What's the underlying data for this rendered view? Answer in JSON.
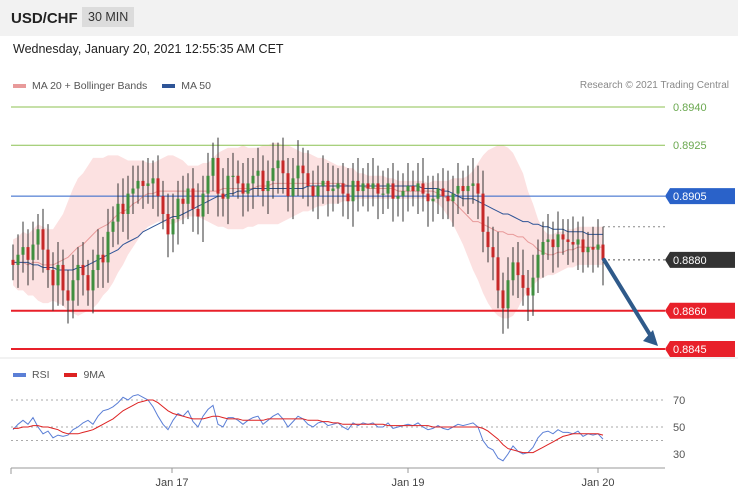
{
  "header": {
    "pair": "USD/CHF",
    "timeframe": "30 MIN"
  },
  "timestamp": "Wednesday, January 20, 2021 12:55:35 AM CET",
  "legend_main": [
    {
      "label": "MA 20 + Bollinger Bands",
      "color": "#e89a9a"
    },
    {
      "label": "MA 50",
      "color": "#2f5597"
    }
  ],
  "legend_rsi": [
    {
      "label": "RSI",
      "color": "#5b7fd6"
    },
    {
      "label": "9MA",
      "color": "#dd2222"
    }
  ],
  "credit": "Research © 2021 Trading Central",
  "colors": {
    "resistance": "#8cc152",
    "pivot": "#2a62c9",
    "support": "#e8202a",
    "last": "#333333",
    "arrow": "#2f5a8a"
  },
  "chart_data": [
    {
      "type": "candlestick",
      "pair": "USD/CHF",
      "ylim": [
        0.884,
        0.895
      ],
      "levels": [
        {
          "value": 0.894,
          "label": "0.8940",
          "kind": "resistance"
        },
        {
          "value": 0.8925,
          "label": "0.8925",
          "kind": "resistance"
        },
        {
          "value": 0.8905,
          "label": "0.8905",
          "kind": "pivot"
        },
        {
          "value": 0.888,
          "label": "0.8880",
          "kind": "last"
        },
        {
          "value": 0.886,
          "label": "0.8860",
          "kind": "support"
        },
        {
          "value": 0.8845,
          "label": "0.8845",
          "kind": "support"
        }
      ],
      "x_tick_labels": [
        "Jan 17",
        "Jan 19",
        "Jan 20"
      ],
      "forecast_arrow": {
        "from": 0.888,
        "to": 0.8845
      },
      "close": [
        0.8878,
        0.8882,
        0.8885,
        0.888,
        0.8886,
        0.8892,
        0.8884,
        0.8876,
        0.887,
        0.8878,
        0.8868,
        0.8864,
        0.8872,
        0.8878,
        0.8874,
        0.8868,
        0.8876,
        0.8882,
        0.8879,
        0.8891,
        0.8895,
        0.8902,
        0.8898,
        0.8906,
        0.8908,
        0.8911,
        0.8909,
        0.891,
        0.8912,
        0.8905,
        0.8898,
        0.889,
        0.8896,
        0.8904,
        0.8902,
        0.8908,
        0.89,
        0.8897,
        0.8906,
        0.8913,
        0.892,
        0.8906,
        0.8904,
        0.8913,
        0.8913,
        0.891,
        0.8906,
        0.891,
        0.8913,
        0.8915,
        0.8907,
        0.8911,
        0.8916,
        0.8919,
        0.8914,
        0.8905,
        0.8912,
        0.8917,
        0.8914,
        0.8909,
        0.8905,
        0.8909,
        0.8911,
        0.8907,
        0.8908,
        0.891,
        0.8906,
        0.8903,
        0.8911,
        0.8907,
        0.891,
        0.8908,
        0.891,
        0.8906,
        0.8906,
        0.891,
        0.8904,
        0.8905,
        0.8907,
        0.8909,
        0.8907,
        0.891,
        0.8906,
        0.8903,
        0.8904,
        0.8908,
        0.8905,
        0.8903,
        0.8906,
        0.8909,
        0.8907,
        0.8909,
        0.891,
        0.8906,
        0.8891,
        0.8885,
        0.8881,
        0.8868,
        0.8861,
        0.8872,
        0.8879,
        0.8874,
        0.8869,
        0.8866,
        0.8873,
        0.8882,
        0.8887,
        0.8888,
        0.8885,
        0.889,
        0.8888,
        0.8887,
        0.8886,
        0.8888,
        0.8883,
        0.8885,
        0.8884,
        0.8886,
        0.888
      ],
      "bollinger_upper": [
        0.8888,
        0.8889,
        0.8891,
        0.889,
        0.8892,
        0.8894,
        0.8893,
        0.8892,
        0.8892,
        0.8895,
        0.8898,
        0.8903,
        0.8908,
        0.8912,
        0.8914,
        0.8917,
        0.892,
        0.892,
        0.892,
        0.8921,
        0.8921,
        0.8921,
        0.892,
        0.8919,
        0.8919,
        0.8919,
        0.8919,
        0.8918,
        0.8918,
        0.8919,
        0.892,
        0.8921,
        0.8921,
        0.892,
        0.8919,
        0.8917,
        0.8917,
        0.8917,
        0.8918,
        0.8918,
        0.892,
        0.8922,
        0.8923,
        0.8924,
        0.8924,
        0.8924,
        0.8925,
        0.8924,
        0.8924,
        0.8924,
        0.8925,
        0.8925,
        0.8926,
        0.8926,
        0.8925,
        0.8925,
        0.8924,
        0.8923,
        0.8922,
        0.8922,
        0.8921,
        0.892,
        0.892,
        0.8919,
        0.8918,
        0.8917,
        0.8917,
        0.8916,
        0.8916,
        0.8914,
        0.8914,
        0.8913,
        0.8913,
        0.8913,
        0.8913,
        0.8912,
        0.8912,
        0.8911,
        0.8911,
        0.8911,
        0.8911,
        0.8911,
        0.8911,
        0.891,
        0.8911,
        0.8911,
        0.8911,
        0.8911,
        0.8912,
        0.8912,
        0.8912,
        0.8913,
        0.8915,
        0.8918,
        0.8921,
        0.8923,
        0.8924,
        0.8925,
        0.8925,
        0.8924,
        0.8922,
        0.8918,
        0.8914,
        0.8907,
        0.8902,
        0.8896,
        0.8892,
        0.889,
        0.889,
        0.8891,
        0.8891,
        0.8892,
        0.8892,
        0.8893,
        0.8893,
        0.8893,
        0.8893,
        0.8893,
        0.8893
      ],
      "bollinger_lower": [
        0.887,
        0.8868,
        0.8868,
        0.8866,
        0.8866,
        0.8864,
        0.8863,
        0.8863,
        0.8864,
        0.8863,
        0.8862,
        0.886,
        0.8859,
        0.8858,
        0.8859,
        0.886,
        0.8861,
        0.8863,
        0.8866,
        0.8868,
        0.8871,
        0.8875,
        0.8878,
        0.8882,
        0.8885,
        0.8888,
        0.8891,
        0.8893,
        0.8894,
        0.8895,
        0.8895,
        0.8894,
        0.8894,
        0.8895,
        0.8896,
        0.8897,
        0.8897,
        0.8897,
        0.8896,
        0.8895,
        0.8894,
        0.8893,
        0.8893,
        0.8892,
        0.8892,
        0.8892,
        0.8892,
        0.8893,
        0.8893,
        0.8894,
        0.8894,
        0.8894,
        0.8894,
        0.8894,
        0.8895,
        0.8896,
        0.8897,
        0.8898,
        0.8899,
        0.8899,
        0.89,
        0.8901,
        0.8901,
        0.8902,
        0.8902,
        0.8902,
        0.8903,
        0.8903,
        0.8903,
        0.8904,
        0.8904,
        0.8904,
        0.8904,
        0.8904,
        0.8904,
        0.8904,
        0.8904,
        0.8904,
        0.8904,
        0.8904,
        0.8904,
        0.8904,
        0.8904,
        0.8904,
        0.8903,
        0.8902,
        0.89,
        0.8897,
        0.8894,
        0.889,
        0.8886,
        0.8881,
        0.8876,
        0.8872,
        0.8867,
        0.8863,
        0.886,
        0.8858,
        0.8857,
        0.8857,
        0.8858,
        0.8861,
        0.8865,
        0.8868,
        0.887,
        0.8872,
        0.8873,
        0.8874,
        0.8874,
        0.8875,
        0.8876,
        0.8877,
        0.8877,
        0.8878,
        0.8878,
        0.8878,
        0.8878,
        0.8878,
        0.8878
      ],
      "ma20": [
        0.8879,
        0.8879,
        0.8879,
        0.8878,
        0.8879,
        0.8879,
        0.8878,
        0.8878,
        0.8878,
        0.8879,
        0.888,
        0.8881,
        0.8883,
        0.8885,
        0.8886,
        0.8888,
        0.889,
        0.8892,
        0.8893,
        0.8894,
        0.8896,
        0.8898,
        0.8899,
        0.89,
        0.8902,
        0.8903,
        0.8905,
        0.8906,
        0.8906,
        0.8907,
        0.8907,
        0.8907,
        0.8907,
        0.8907,
        0.8907,
        0.8907,
        0.8907,
        0.8907,
        0.8907,
        0.8907,
        0.8907,
        0.8907,
        0.8908,
        0.8908,
        0.8908,
        0.8908,
        0.8908,
        0.8908,
        0.8908,
        0.8909,
        0.8909,
        0.8909,
        0.891,
        0.891,
        0.891,
        0.891,
        0.891,
        0.891,
        0.891,
        0.891,
        0.891,
        0.891,
        0.891,
        0.891,
        0.891,
        0.891,
        0.891,
        0.8909,
        0.8909,
        0.8909,
        0.8909,
        0.8908,
        0.8908,
        0.8908,
        0.8908,
        0.8908,
        0.8908,
        0.8907,
        0.8907,
        0.8907,
        0.8907,
        0.8907,
        0.8907,
        0.8907,
        0.8907,
        0.8906,
        0.8905,
        0.8904,
        0.8903,
        0.8901,
        0.8899,
        0.8897,
        0.8895,
        0.8895,
        0.8894,
        0.8893,
        0.8892,
        0.8891,
        0.8891,
        0.889,
        0.889,
        0.8889,
        0.8889,
        0.8887,
        0.8886,
        0.8884,
        0.8883,
        0.8882,
        0.8882,
        0.8883,
        0.8883,
        0.8884,
        0.8884,
        0.8885,
        0.8885,
        0.8885,
        0.8885,
        0.8885,
        0.8885
      ],
      "ma50": [
        0.8879,
        0.8879,
        0.8879,
        0.8879,
        0.8878,
        0.8878,
        0.8877,
        0.8877,
        0.8877,
        0.8876,
        0.8876,
        0.8876,
        0.8876,
        0.8877,
        0.8877,
        0.8878,
        0.8879,
        0.888,
        0.8881,
        0.8882,
        0.8883,
        0.8884,
        0.8886,
        0.8887,
        0.8888,
        0.8889,
        0.8891,
        0.8892,
        0.8893,
        0.8894,
        0.8895,
        0.8896,
        0.8897,
        0.8897,
        0.8898,
        0.8899,
        0.89,
        0.8901,
        0.8902,
        0.8903,
        0.8904,
        0.8905,
        0.8905,
        0.8906,
        0.8906,
        0.8907,
        0.8907,
        0.8907,
        0.8908,
        0.8908,
        0.8908,
        0.8908,
        0.8908,
        0.8908,
        0.8908,
        0.8908,
        0.8908,
        0.8908,
        0.8908,
        0.8909,
        0.8909,
        0.8909,
        0.8909,
        0.8909,
        0.8909,
        0.8909,
        0.8909,
        0.8909,
        0.8909,
        0.8909,
        0.8909,
        0.8909,
        0.8909,
        0.8909,
        0.8909,
        0.8909,
        0.8909,
        0.8909,
        0.8909,
        0.8909,
        0.8909,
        0.8909,
        0.8908,
        0.8908,
        0.8908,
        0.8908,
        0.8907,
        0.8907,
        0.8906,
        0.8905,
        0.8904,
        0.8904,
        0.8904,
        0.8903,
        0.8902,
        0.8901,
        0.89,
        0.8899,
        0.8898,
        0.8898,
        0.8897,
        0.8896,
        0.8895,
        0.8895,
        0.8894,
        0.8894,
        0.8893,
        0.8893,
        0.8892,
        0.8892,
        0.8892,
        0.8891,
        0.8891,
        0.8891,
        0.8891,
        0.889,
        0.889,
        0.889,
        0.889
      ]
    },
    {
      "type": "line",
      "name": "RSI",
      "ylim": [
        20,
        80
      ],
      "y_ticks": [
        70,
        50,
        30
      ],
      "dotted_levels": [
        70,
        50,
        40
      ],
      "series": [
        {
          "name": "RSI",
          "values": [
            48,
            52,
            55,
            52,
            57,
            50,
            45,
            47,
            42,
            44,
            43,
            44,
            48,
            50,
            53,
            55,
            52,
            58,
            62,
            63,
            65,
            68,
            72,
            70,
            73,
            74,
            72,
            70,
            65,
            58,
            52,
            48,
            55,
            60,
            58,
            62,
            54,
            50,
            58,
            63,
            66,
            52,
            50,
            57,
            57,
            55,
            52,
            55,
            57,
            58,
            52,
            55,
            58,
            60,
            56,
            50,
            54,
            58,
            56,
            52,
            50,
            53,
            54,
            51,
            52,
            53,
            50,
            48,
            53,
            51,
            53,
            52,
            53,
            50,
            50,
            53,
            49,
            50,
            51,
            52,
            51,
            53,
            50,
            48,
            49,
            51,
            49,
            48,
            50,
            52,
            51,
            52,
            53,
            50,
            40,
            35,
            33,
            27,
            25,
            30,
            36,
            32,
            30,
            31,
            35,
            42,
            46,
            47,
            45,
            48,
            46,
            46,
            45,
            47,
            43,
            45,
            44,
            45,
            41
          ]
        },
        {
          "name": "9MA",
          "values": [
            49,
            49,
            50,
            50,
            51,
            51,
            50,
            50,
            49,
            48,
            46,
            45,
            45,
            45,
            46,
            47,
            48,
            50,
            52,
            54,
            56,
            59,
            62,
            64,
            66,
            68,
            69,
            70,
            70,
            68,
            65,
            62,
            60,
            59,
            58,
            57,
            56,
            56,
            56,
            57,
            58,
            58,
            57,
            56,
            56,
            56,
            55,
            55,
            55,
            55,
            55,
            56,
            56,
            56,
            56,
            56,
            56,
            56,
            56,
            55,
            55,
            55,
            54,
            54,
            53,
            53,
            52,
            52,
            52,
            52,
            52,
            52,
            52,
            52,
            52,
            51,
            51,
            51,
            51,
            51,
            51,
            51,
            51,
            51,
            50,
            50,
            50,
            50,
            50,
            50,
            50,
            50,
            50,
            50,
            49,
            47,
            44,
            41,
            37,
            34,
            33,
            32,
            31,
            31,
            31,
            33,
            35,
            37,
            39,
            41,
            43,
            44,
            45,
            45,
            45,
            45,
            45,
            45,
            44
          ]
        }
      ]
    }
  ]
}
